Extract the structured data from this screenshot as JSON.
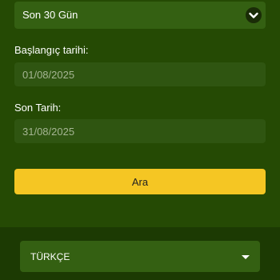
{
  "filter": {
    "period_select": {
      "value": "Son 30 Gün",
      "icon": "chevron-down-icon"
    },
    "start_date": {
      "label": "Başlangıç tarihi:",
      "value": "01/08/2025"
    },
    "end_date": {
      "label": "Son Tarih:",
      "value": "31/08/2025"
    },
    "search_button": {
      "label": "Ara"
    }
  },
  "language_select": {
    "value": "TÜRKÇE",
    "icon": "caret-down-icon"
  },
  "colors": {
    "background": "#254a04",
    "footer_background": "#1c3a03",
    "field_background": "#2f5511",
    "select_background": "#346012",
    "accent": "#f5c623"
  }
}
